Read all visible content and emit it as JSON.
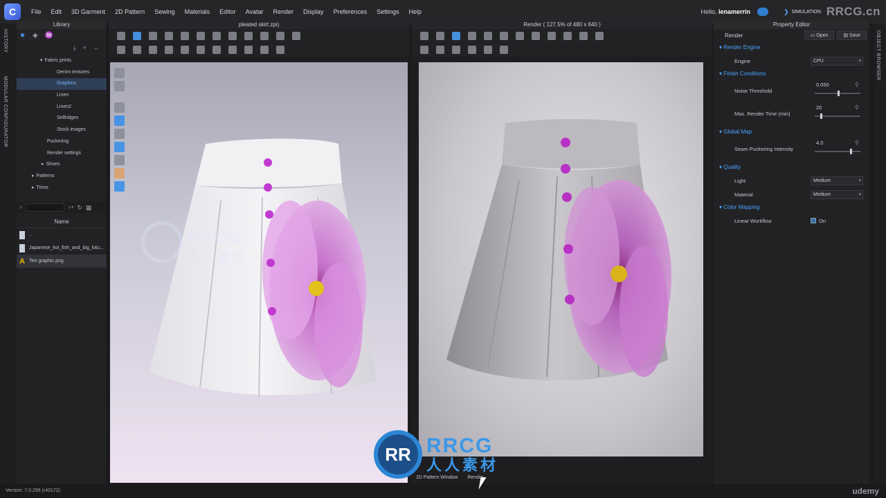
{
  "app": {
    "logo": "C",
    "menu": [
      "File",
      "Edit",
      "3D Garment",
      "2D Pattern",
      "Sewing",
      "Materials",
      "Editor",
      "Avatar",
      "Render",
      "Display",
      "Preferences",
      "Settings",
      "Help"
    ],
    "greeting": "Hello,",
    "username": "lenamerrin",
    "mode": "SIMULATION",
    "watermark_tr": "RRCG.cn"
  },
  "left_tabs": [
    "HISTORY",
    "MODULAR CONFIGURATOR"
  ],
  "library": {
    "title": "Library",
    "tree": [
      {
        "label": "Fabric prints",
        "indent": 34,
        "arrow": "▾"
      },
      {
        "label": "Denim textures",
        "indent": 58,
        "arrow": ""
      },
      {
        "label": "Graphics",
        "indent": 58,
        "arrow": "",
        "selected": true
      },
      {
        "label": "Linen",
        "indent": 58,
        "arrow": ""
      },
      {
        "label": "Linen2",
        "indent": 58,
        "arrow": ""
      },
      {
        "label": "Selfridges",
        "indent": 58,
        "arrow": ""
      },
      {
        "label": "Stock images",
        "indent": 58,
        "arrow": ""
      },
      {
        "label": "Puckering",
        "indent": 44,
        "arrow": ""
      },
      {
        "label": "Render settings",
        "indent": 44,
        "arrow": ""
      },
      {
        "label": "Shoes",
        "indent": 36,
        "arrow": "▸"
      },
      {
        "label": "Patterns",
        "indent": 22,
        "arrow": "▸"
      },
      {
        "label": "Trims",
        "indent": 22,
        "arrow": "▸"
      }
    ],
    "column_header": "Name",
    "files": [
      {
        "name": "..",
        "type": "folder"
      },
      {
        "name": "Japanese_koi_fish_and_big_lotu...",
        "type": "image"
      },
      {
        "name": "Tee graphic.png",
        "type": "warning",
        "selected": true
      }
    ]
  },
  "viewport3d": {
    "title": "pleated skirt.zprj",
    "ghost_wm": "RRCG",
    "ghost_cn": "人人素材"
  },
  "render_view": {
    "title": "Render ( 127.5% of 480 x 640 )",
    "bottom_tabs": [
      "2D Pattern Window",
      "Render"
    ]
  },
  "property_editor": {
    "title": "Property Editor",
    "header_label": "Render",
    "open_label": "Open",
    "save_label": "Save",
    "render_engine": {
      "section": "Render Engine",
      "label": "Engine",
      "value": "CPU"
    },
    "finish": {
      "section": "Finish Conditions",
      "noise_label": "Noise Threshold",
      "noise_value": "0.050",
      "noise_level": 0.5,
      "time_label": "Max. Render Time (min)",
      "time_value": "20",
      "time_level": 0.12
    },
    "global_map": {
      "section": "Global Map",
      "label": "Seam Puckering Intensity",
      "value": "4.0",
      "level": 0.78
    },
    "quality": {
      "section": "Quality",
      "light_label": "Light",
      "light_value": "Medium",
      "material_label": "Material",
      "material_value": "Medium"
    },
    "color_mapping": {
      "section": "Color Mapping",
      "label": "Linear Workflow",
      "value": "On"
    }
  },
  "right_tabs": [
    "OBJECT BROWSER"
  ],
  "status": {
    "version": "Version: 7.0.296 (r40172)",
    "brand": "udemy"
  },
  "watermark": {
    "big": "RRCG",
    "cn": "人人素材",
    "logo": "RR"
  },
  "colors": {
    "accent": "#4aa3ff",
    "button_purple": "#c03ad0",
    "flower": "#d57fe0"
  }
}
